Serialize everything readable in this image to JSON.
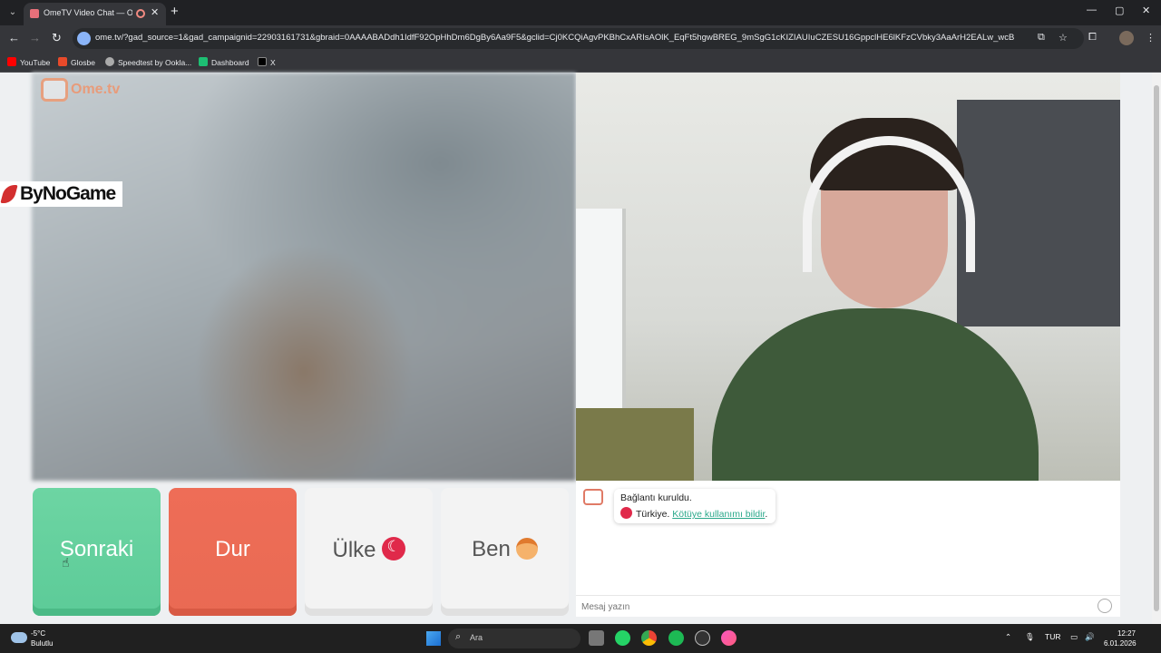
{
  "browser": {
    "tab": {
      "title": "OmeTV Video Chat — Ome",
      "close": "✕"
    },
    "new_tab": "+",
    "window_controls": {
      "minimize": "—",
      "maximize": "▢",
      "close": "✕"
    },
    "nav": {
      "back": "←",
      "forward": "→",
      "reload": "↻"
    },
    "url": "ome.tv/?gad_source=1&gad_campaignid=22903161731&gbraid=0AAAABADdh1IdfF92OpHhDm6DgBy6Aa9F5&gclid=Cj0KCQiAgvPKBhCxARIsAOlK_EqFt5hgwBREG_9mSgG1cKIZIAUIuCZESU16GppclHE6lKFzCVbky3AaArH2EALw_wcB",
    "bookmarks": [
      {
        "label": "YouTube",
        "color": "#ff0000"
      },
      {
        "label": "Glosbe",
        "color": "#e84a2a"
      },
      {
        "label": "Speedtest by Ookla...",
        "color": "#aaaaaa"
      },
      {
        "label": "Dashboard",
        "color": "#1dbf73"
      },
      {
        "label": "X",
        "color": "#000000"
      }
    ]
  },
  "app": {
    "logo_text": "Ome.tv",
    "overlay_brand": "ByNoGame",
    "buttons": {
      "next": "Sonraki",
      "stop": "Dur",
      "country": "Ülke",
      "me": "Ben"
    },
    "chat": {
      "system_line1": "Bağlantı kuruldu.",
      "system_country": "Türkiye.",
      "report_link": "Kötüye kullanımı bildir",
      "report_suffix": ".",
      "input_placeholder": "Mesaj yazın"
    },
    "colors": {
      "next": "#62ce9b",
      "stop": "#eb6a53",
      "link": "#2aa88a"
    }
  },
  "taskbar": {
    "weather_temp": "-5°C",
    "weather_desc": "Bulutlu",
    "search_placeholder": "Ara",
    "lang": "TUR",
    "time": "12:27",
    "date": "6.01.2026"
  }
}
